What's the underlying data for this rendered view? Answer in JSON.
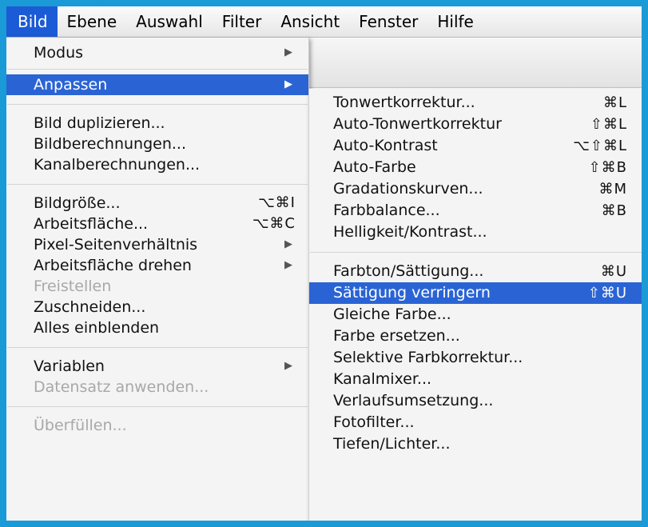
{
  "menubar": {
    "items": [
      "Bild",
      "Ebene",
      "Auswahl",
      "Filter",
      "Ansicht",
      "Fenster",
      "Hilfe"
    ],
    "active": "Bild"
  },
  "main_menu": {
    "items": [
      {
        "label": "Modus",
        "shortcut": "",
        "submenu": true
      },
      {
        "label": "Anpassen",
        "shortcut": "",
        "submenu": true,
        "highlighted": true
      },
      {
        "label": "Bild duplizieren...",
        "shortcut": ""
      },
      {
        "label": "Bildberechnungen...",
        "shortcut": ""
      },
      {
        "label": "Kanalberechnungen...",
        "shortcut": ""
      },
      {
        "label": "Bildgröße...",
        "shortcut": "⌥⌘I"
      },
      {
        "label": "Arbeitsfläche...",
        "shortcut": "⌥⌘C"
      },
      {
        "label": "Pixel-Seitenverhältnis",
        "shortcut": "",
        "submenu": true
      },
      {
        "label": "Arbeitsfläche drehen",
        "shortcut": "",
        "submenu": true
      },
      {
        "label": "Freistellen",
        "shortcut": "",
        "disabled": true
      },
      {
        "label": "Zuschneiden...",
        "shortcut": ""
      },
      {
        "label": "Alles einblenden",
        "shortcut": ""
      },
      {
        "label": "Variablen",
        "shortcut": "",
        "submenu": true
      },
      {
        "label": "Datensatz anwenden...",
        "shortcut": "",
        "disabled": true
      },
      {
        "label": "Überfüllen...",
        "shortcut": "",
        "disabled": true
      }
    ]
  },
  "sub_menu": {
    "items": [
      {
        "label": "Tonwertkorrektur...",
        "shortcut": "⌘L"
      },
      {
        "label": "Auto-Tonwertkorrektur",
        "shortcut": "⇧⌘L"
      },
      {
        "label": "Auto-Kontrast",
        "shortcut": "⌥⇧⌘L"
      },
      {
        "label": "Auto-Farbe",
        "shortcut": "⇧⌘B"
      },
      {
        "label": "Gradationskurven...",
        "shortcut": "⌘M"
      },
      {
        "label": "Farbbalance...",
        "shortcut": "⌘B"
      },
      {
        "label": "Helligkeit/Kontrast...",
        "shortcut": ""
      },
      {
        "label": "Farbton/Sättigung...",
        "shortcut": "⌘U"
      },
      {
        "label": "Sättigung verringern",
        "shortcut": "⇧⌘U",
        "highlighted": true
      },
      {
        "label": "Gleiche Farbe...",
        "shortcut": ""
      },
      {
        "label": "Farbe ersetzen...",
        "shortcut": ""
      },
      {
        "label": "Selektive Farbkorrektur...",
        "shortcut": ""
      },
      {
        "label": "Kanalmixer...",
        "shortcut": ""
      },
      {
        "label": "Verlaufsumsetzung...",
        "shortcut": ""
      },
      {
        "label": "Fotofilter...",
        "shortcut": ""
      },
      {
        "label": "Tiefen/Lichter...",
        "shortcut": ""
      }
    ]
  },
  "colors": {
    "background": "#1a9ad6",
    "highlight": "#2a64d4",
    "menu": "#f4f4f4",
    "disabled_text": "#a8a8a8"
  },
  "icons": {
    "submenu_arrow": "triangle-right-icon"
  }
}
